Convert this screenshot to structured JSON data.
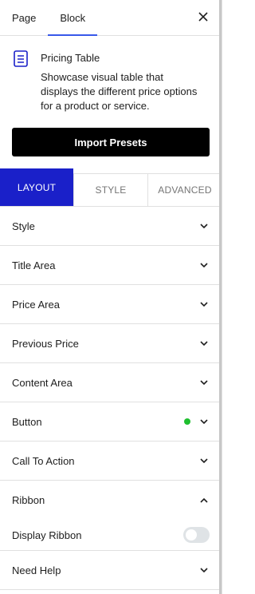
{
  "top_tabs": [
    {
      "label": "Page",
      "active": false
    },
    {
      "label": "Block",
      "active": true
    }
  ],
  "close_icon": "close-icon",
  "block": {
    "icon": "pricing-table-icon",
    "title": "Pricing Table",
    "description": "Showcase visual table that displays the different price options for a product or service."
  },
  "import_button": "Import Presets",
  "sub_tabs": [
    {
      "label": "LAYOUT",
      "active": true
    },
    {
      "label": "STYLE",
      "active": false
    },
    {
      "label": "ADVANCED",
      "active": false
    }
  ],
  "panels": [
    {
      "label": "Style"
    },
    {
      "label": "Title Area"
    },
    {
      "label": "Price Area"
    },
    {
      "label": "Previous Price"
    },
    {
      "label": "Content Area"
    },
    {
      "label": "Button",
      "indicator": true
    },
    {
      "label": "Call To Action"
    }
  ],
  "ribbon": {
    "label": "Ribbon",
    "expanded": true,
    "toggle_label": "Display Ribbon",
    "toggle_on": false
  },
  "need_help": "Need Help",
  "colors": {
    "accent": "#3858e9",
    "active_tab": "#1a20c9",
    "indicator": "#1fbf2f",
    "button_bg": "#000000"
  }
}
